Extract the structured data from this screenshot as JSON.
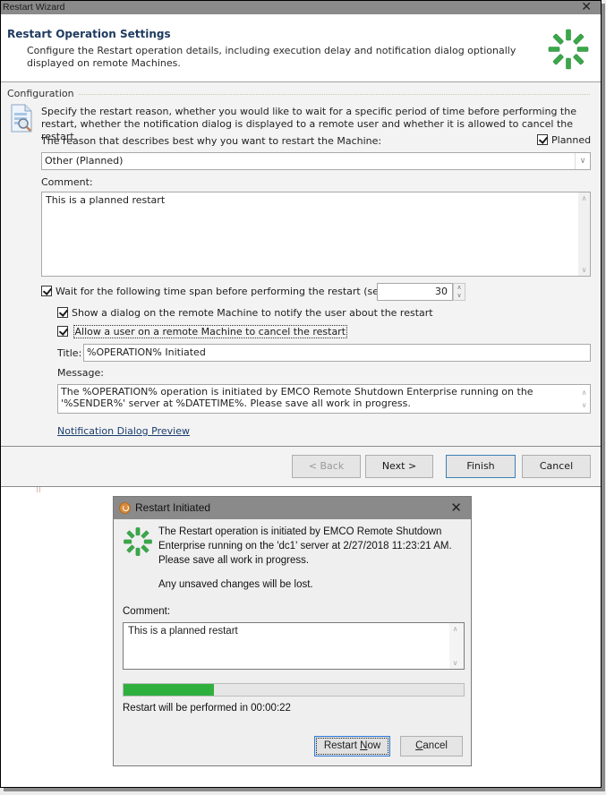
{
  "wizard": {
    "window_title": "Restart Wizard",
    "header": {
      "title": "Restart Operation Settings",
      "description": "Configure the Restart operation details, including execution delay and notification dialog optionally displayed on remote Machines."
    },
    "configuration": {
      "group_label": "Configuration",
      "intro": "Specify the restart reason, whether you would like to wait for a specific period of time before performing the restart, whether the notification dialog is displayed to a remote user and whether it is allowed to cancel the restart.",
      "reason_label": "The reason that describes best why you want to restart the Machine:",
      "planned_label": "Planned",
      "planned_checked": true,
      "reason_selected": "Other (Planned)",
      "comment_label": "Comment:",
      "comment_value": "This is a planned restart",
      "wait_label": "Wait for the following time span before performing the restart (sec):",
      "wait_checked": true,
      "wait_seconds": "30",
      "show_dialog_label": "Show a dialog on the remote Machine to notify the user about the restart",
      "show_dialog_checked": true,
      "allow_cancel_label": "Allow a user on a remote Machine to cancel the restart",
      "allow_cancel_checked": true,
      "title_label": "Title:",
      "title_value": "%OPERATION% Initiated",
      "message_label": "Message:",
      "message_value": "The %OPERATION% operation is initiated by EMCO Remote Shutdown Enterprise running on the '%SENDER%' server at %DATETIME%. Please save all work in progress.",
      "preview_link": "Notification Dialog Preview"
    },
    "buttons": {
      "back": "< Back",
      "next": "Next >",
      "finish": "Finish",
      "cancel": "Cancel"
    }
  },
  "notification_dialog": {
    "title": "Restart Initiated",
    "message": "The Restart operation is initiated by EMCO Remote Shutdown Enterprise running on the 'dc1' server at 2/27/2018 11:23:21 AM. Please save all work in progress.",
    "warning": "Any unsaved changes will be lost.",
    "comment_label": "Comment:",
    "comment_value": "This is a planned restart",
    "progress_fraction": 0.265,
    "status": "Restart will be performed in 00:00:22",
    "restart_now_prefix": "Restart ",
    "restart_now_accel": "N",
    "restart_now_suffix": "ow",
    "cancel_accel": "C",
    "cancel_suffix": "ancel"
  },
  "colors": {
    "accent_green": "#2fb03e",
    "spinner_green": "#3aa84a",
    "title_bar": "#8a8a8a",
    "default_button_border": "#2c7be0"
  }
}
